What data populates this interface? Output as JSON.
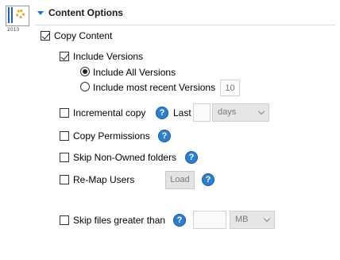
{
  "header": {
    "title": "Content Options",
    "icon_year": "2013"
  },
  "copy_content": {
    "label": "Copy Content",
    "checked": true
  },
  "include_versions": {
    "label": "Include Versions",
    "checked": true
  },
  "version_mode": {
    "all_label": "Include All Versions",
    "recent_label": "Include most recent Versions",
    "recent_count": "10",
    "selected": "all"
  },
  "incremental": {
    "label": "Incremental copy",
    "last_label": "Last",
    "last_value": "",
    "unit": "days"
  },
  "copy_permissions": {
    "label": "Copy Permissions"
  },
  "skip_non_owned": {
    "label": "Skip Non-Owned folders"
  },
  "remap_users": {
    "label": "Re-Map Users",
    "load_label": "Load"
  },
  "skip_files": {
    "label": "Skip files greater than",
    "size_value": "",
    "unit": "MB"
  },
  "help_glyph": "?"
}
